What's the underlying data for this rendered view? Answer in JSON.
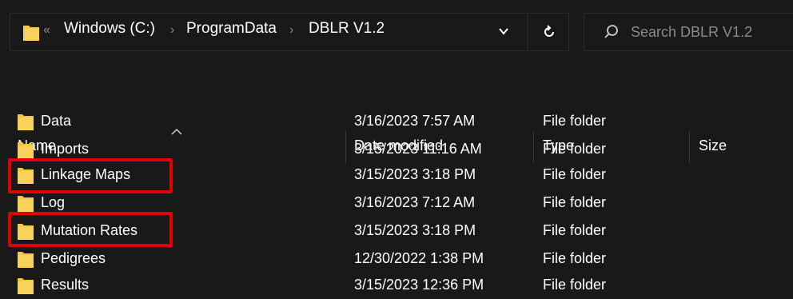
{
  "address_bar": {
    "overflow": "«",
    "crumbs": [
      "Windows (C:)",
      "ProgramData",
      "DBLR V1.2"
    ]
  },
  "search": {
    "placeholder": "Search DBLR V1.2"
  },
  "columns": [
    "Name",
    "Date modified",
    "Type",
    "Size"
  ],
  "rows": [
    {
      "name": "Data",
      "date": "3/16/2023 7:57 AM",
      "type": "File folder"
    },
    {
      "name": "Imports",
      "date": "3/15/2023 11:16 AM",
      "type": "File folder"
    },
    {
      "name": "Linkage Maps",
      "date": "3/15/2023 3:18 PM",
      "type": "File folder"
    },
    {
      "name": "Log",
      "date": "3/16/2023 7:12 AM",
      "type": "File folder"
    },
    {
      "name": "Mutation Rates",
      "date": "3/15/2023 3:18 PM",
      "type": "File folder"
    },
    {
      "name": "Pedigrees",
      "date": "12/30/2022 1:38 PM",
      "type": "File folder"
    },
    {
      "name": "Results",
      "date": "3/15/2023 12:36 PM",
      "type": "File folder"
    }
  ],
  "highlighted_rows": [
    "Linkage Maps",
    "Mutation Rates"
  ],
  "colors": {
    "background": "#191919",
    "folder": "#f5c842",
    "highlight": "#e00000"
  }
}
